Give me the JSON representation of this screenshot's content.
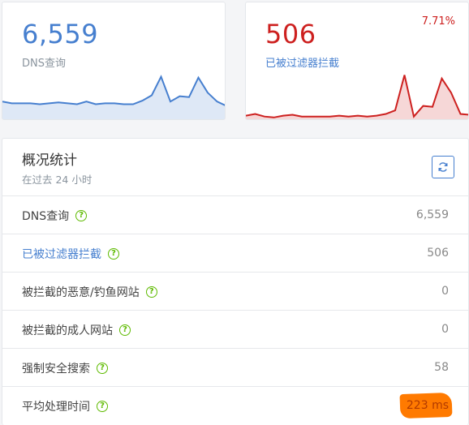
{
  "dns_card": {
    "value": "6,559",
    "label": "DNS查询",
    "color": "#467fcf",
    "sparkline": [
      20,
      18,
      18,
      18,
      17,
      18,
      19,
      18,
      17,
      20,
      17,
      18,
      18,
      17,
      17,
      21,
      27,
      48,
      20,
      26,
      25,
      47,
      30,
      20,
      15
    ]
  },
  "blocked_card": {
    "value": "506",
    "label": "已被过滤器拦截",
    "percent": "7.71%",
    "color": "#cd201f",
    "sparkline": [
      4,
      6,
      3,
      2,
      4,
      5,
      3,
      3,
      3,
      3,
      4,
      3,
      4,
      3,
      4,
      6,
      10,
      50,
      3,
      15,
      14,
      46,
      30,
      6,
      5
    ]
  },
  "stats": {
    "title": "概况统计",
    "subtitle": "在过去 24 小时",
    "refresh_icon": "refresh-icon",
    "rows": [
      {
        "label": "DNS查询",
        "value": "6,559"
      },
      {
        "label": "已被过滤器拦截",
        "value": "506"
      },
      {
        "label": "被拦截的恶意/钓鱼网站",
        "value": "0"
      },
      {
        "label": "被拦截的成人网站",
        "value": "0"
      },
      {
        "label": "强制安全搜索",
        "value": "58"
      },
      {
        "label": "平均处理时间",
        "value": "223 ms"
      }
    ]
  }
}
